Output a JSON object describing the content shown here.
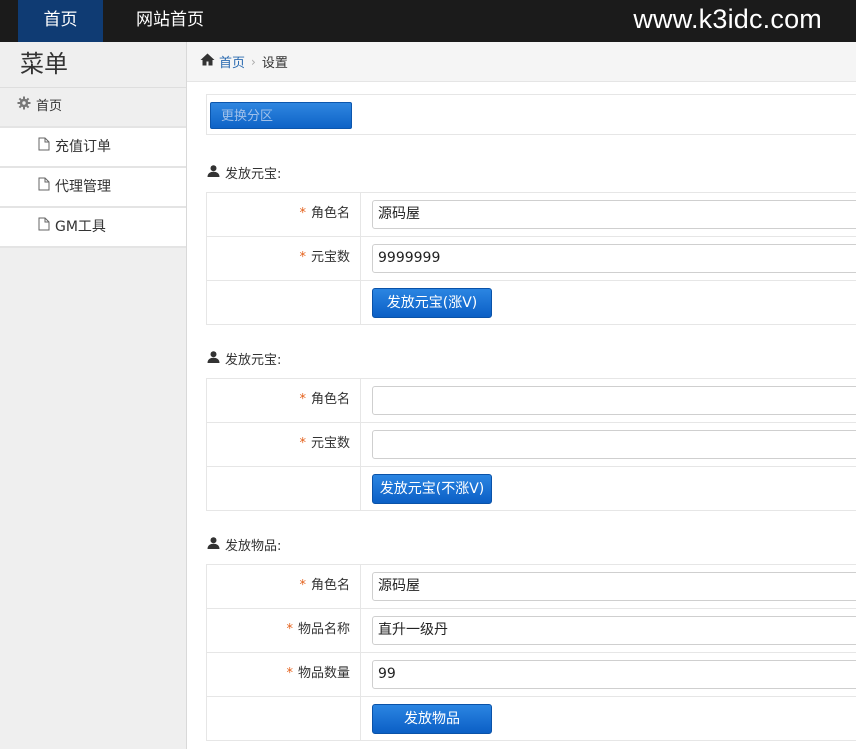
{
  "topbar": {
    "nav_home": "首页",
    "nav_site": "网站首页",
    "brand": "www.k3idc.com"
  },
  "sidebar": {
    "title": "菜单",
    "home": "首页",
    "items": [
      {
        "label": "充值订单"
      },
      {
        "label": "代理管理"
      },
      {
        "label": "GM工具"
      }
    ]
  },
  "breadcrumb": {
    "home": "首页",
    "current": "设置"
  },
  "switch_button": "更换分区",
  "sections": [
    {
      "title": "发放元宝:",
      "fields": [
        {
          "label": "角色名",
          "value": "源码屋"
        },
        {
          "label": "元宝数",
          "value": "9999999"
        }
      ],
      "button": "发放元宝(涨V)"
    },
    {
      "title": "发放元宝:",
      "fields": [
        {
          "label": "角色名",
          "value": ""
        },
        {
          "label": "元宝数",
          "value": ""
        }
      ],
      "button": "发放元宝(不涨V)"
    },
    {
      "title": "发放物品:",
      "fields": [
        {
          "label": "角色名",
          "value": "源码屋"
        },
        {
          "label": "物品名称",
          "value": "直升一级丹"
        },
        {
          "label": "物品数量",
          "value": "99"
        }
      ],
      "button": "发放物品"
    }
  ],
  "required_mark": "*",
  "colors": {
    "topbar": "#1b1b1b",
    "nav_active": "#0f3b73",
    "button": "#0e63c7",
    "required": "#e4601a",
    "link": "#2a6ab0"
  }
}
